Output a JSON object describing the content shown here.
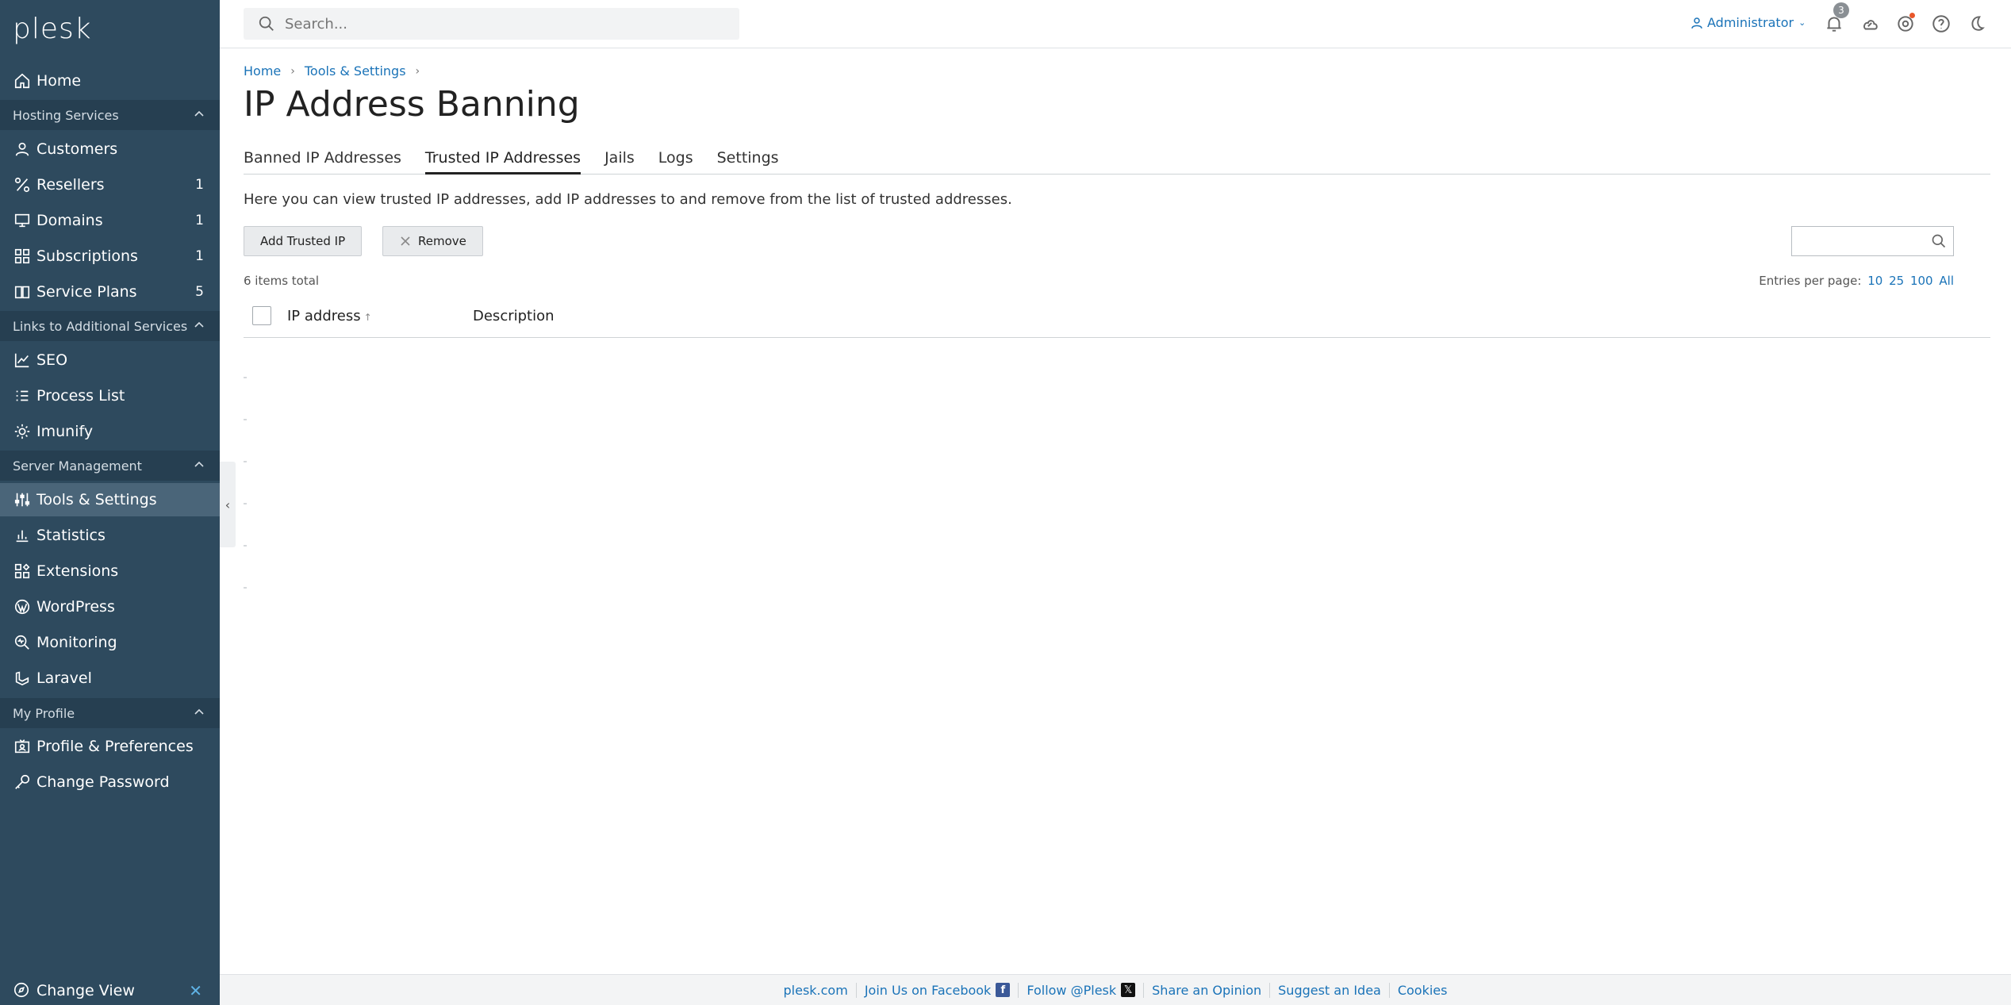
{
  "brand": {
    "logo": "plesk"
  },
  "sidebar": {
    "home": "Home",
    "sections": {
      "hosting": "Hosting Services",
      "links": "Links to Additional Services",
      "server": "Server Management",
      "profile": "My Profile"
    },
    "items": [
      {
        "label": "Customers",
        "count": ""
      },
      {
        "label": "Resellers",
        "count": "1"
      },
      {
        "label": "Domains",
        "count": "1"
      },
      {
        "label": "Subscriptions",
        "count": "1"
      },
      {
        "label": "Service Plans",
        "count": "5"
      },
      {
        "label": "SEO",
        "count": ""
      },
      {
        "label": "Process List",
        "count": ""
      },
      {
        "label": "Imunify",
        "count": ""
      },
      {
        "label": "Tools & Settings",
        "count": ""
      },
      {
        "label": "Statistics",
        "count": ""
      },
      {
        "label": "Extensions",
        "count": ""
      },
      {
        "label": "WordPress",
        "count": ""
      },
      {
        "label": "Monitoring",
        "count": ""
      },
      {
        "label": "Laravel",
        "count": ""
      },
      {
        "label": "Profile & Preferences",
        "count": ""
      },
      {
        "label": "Change Password",
        "count": ""
      }
    ],
    "change_view": "Change View"
  },
  "topbar": {
    "search_placeholder": "Search...",
    "user": "Administrator",
    "notifications_count": "3"
  },
  "breadcrumb": [
    "Home",
    "Tools & Settings"
  ],
  "page": {
    "title": "IP Address Banning",
    "tabs": [
      "Banned IP Addresses",
      "Trusted IP Addresses",
      "Jails",
      "Logs",
      "Settings"
    ],
    "active_tab": "Trusted IP Addresses",
    "description": "Here you can view trusted IP addresses, add IP addresses to and remove from the list of trusted addresses.",
    "add_button": "Add Trusted IP",
    "remove_button": "Remove",
    "total": "6 items total",
    "per_page_label": "Entries per page:",
    "per_page_options": [
      "10",
      "25",
      "100",
      "All"
    ],
    "columns": [
      "IP address",
      "Description"
    ],
    "sort_arrow": "↑"
  },
  "footer": {
    "links": [
      "plesk.com",
      "Join Us on Facebook",
      "Follow @Plesk",
      "Share an Opinion",
      "Suggest an Idea",
      "Cookies"
    ]
  },
  "colors": {
    "sidebar": "#2e4a5e",
    "section": "#263f51",
    "active": "#4a6579",
    "link": "#1a73b8"
  }
}
